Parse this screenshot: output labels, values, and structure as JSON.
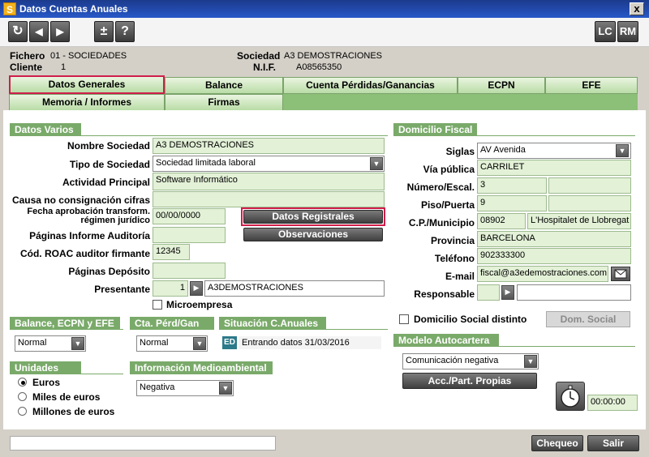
{
  "window": {
    "title": "Datos Cuentas Anuales",
    "app_icon": "S",
    "close": "x"
  },
  "toolbar": {
    "refresh_icon": "↻",
    "prev_icon": "◀",
    "next_icon": "▶",
    "plusminus": "±",
    "help": "?",
    "lc": "LC",
    "rm": "RM"
  },
  "header": {
    "fichero_label": "Fichero",
    "fichero_value": "01 - SOCIEDADES",
    "cliente_label": "Cliente",
    "cliente_value": "1",
    "sociedad_label": "Sociedad",
    "sociedad_value": "A3 DEMOSTRACIONES",
    "nif_label": "N.I.F.",
    "nif_value": "A08565350"
  },
  "tabs": {
    "row1": [
      "Datos Generales",
      "Balance",
      "Cuenta Pérdidas/Ganancias",
      "ECPN",
      "EFE"
    ],
    "row2": [
      "Memoria / Informes",
      "Firmas"
    ]
  },
  "datos_varios": {
    "title": "Datos Varios",
    "nombre_label": "Nombre Sociedad",
    "nombre_value": "A3 DEMOSTRACIONES",
    "tipo_label": "Tipo de Sociedad",
    "tipo_value": "Sociedad limitada laboral",
    "actividad_label": "Actividad Principal",
    "actividad_value": "Software Informático",
    "causa_label": "Causa no consignación cifras",
    "causa_value": "",
    "fecha_label_1": "Fecha aprobación transform.",
    "fecha_label_2": "régimen jurídico",
    "fecha_value": "00/00/0000",
    "datos_registrales_button": "Datos Registrales",
    "observaciones_button": "Observaciones",
    "paginas_informe_label": "Páginas Informe Auditoría",
    "paginas_informe_value": "",
    "roac_label": "Cód. ROAC auditor firmante",
    "roac_value": "12345",
    "paginas_deposito_label": "Páginas Depósito",
    "paginas_deposito_value": "",
    "presentante_label": "Presentante",
    "presentante_code": "1",
    "presentante_name": "A3DEMOSTRACIONES",
    "microempresa_label": "Microempresa"
  },
  "domicilio_fiscal": {
    "title": "Domicilio Fiscal",
    "siglas_label": "Siglas",
    "siglas_value": "AV  Avenida",
    "via_label": "Vía pública",
    "via_value": "CARRILET",
    "numero_label": "Número/Escal.",
    "numero_value": "3",
    "escal_value": "",
    "piso_label": "Piso/Puerta",
    "piso_value": "9",
    "puerta_value": "",
    "cp_label": "C.P./Municipio",
    "cp_value": "08902",
    "municipio_value": "L'Hospitalet de Llobregat",
    "provincia_label": "Provincia",
    "provincia_value": "BARCELONA",
    "telefono_label": "Teléfono",
    "telefono_value": "902333300",
    "email_label": "E-mail",
    "email_value": "fiscal@a3edemostraciones.com",
    "responsable_label": "Responsable",
    "responsable_code": "",
    "responsable_name": "",
    "domicilio_social_label": "Domicilio Social distinto",
    "dom_social_button": "Dom. Social"
  },
  "balance_ecpn_efe": {
    "title": "Balance, ECPN y EFE",
    "value": "Normal"
  },
  "cta_perd_gan": {
    "title": "Cta. Pérd/Gan",
    "value": "Normal"
  },
  "situacion": {
    "title": "Situación C.Anuales",
    "badge": "ED",
    "text": "Entrando datos 31/03/2016"
  },
  "unidades": {
    "title": "Unidades",
    "options": [
      "Euros",
      "Miles de euros",
      "Millones de euros"
    ],
    "selected": 0
  },
  "medioambiental": {
    "title": "Información Medioambiental",
    "value": "Negativa"
  },
  "modelo_autocartera": {
    "title": "Modelo Autocartera",
    "value": "Comunicación negativa",
    "button": "Acc./Part. Propias"
  },
  "timer": {
    "value": "00:00:00"
  },
  "footer": {
    "status_text": "",
    "chequeo": "Chequeo",
    "salir": "Salir"
  },
  "colors": {
    "accent_green": "#7aaa6a",
    "field_green": "#e3f1d7",
    "highlight_red": "#d01e4a",
    "title_blue": "#2858c8"
  }
}
